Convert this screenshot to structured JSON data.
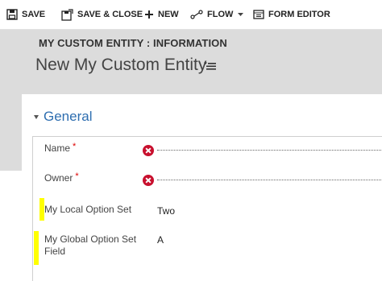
{
  "toolbar": {
    "save": "SAVE",
    "save_close": "SAVE & CLOSE",
    "new": "NEW",
    "flow": "FLOW",
    "form_editor": "FORM EDITOR"
  },
  "header": {
    "entity_form": "MY CUSTOM ENTITY : INFORMATION",
    "record_title": "New My Custom Entity"
  },
  "section": {
    "title": "General"
  },
  "fields": [
    {
      "label": "Name",
      "required": "*",
      "value": ""
    },
    {
      "label": "Owner",
      "required": "*",
      "value": ""
    },
    {
      "label": "My Local Option Set",
      "value": "Two"
    },
    {
      "label_line1": "My Global Option Set",
      "label_line2": "Field",
      "value": "A"
    }
  ],
  "colors": {
    "highlight": "#ffff00",
    "required": "#dd0000",
    "error_icon": "#c8102e",
    "section_title": "#2e6eb0",
    "header_bg": "#dcdcdc"
  }
}
